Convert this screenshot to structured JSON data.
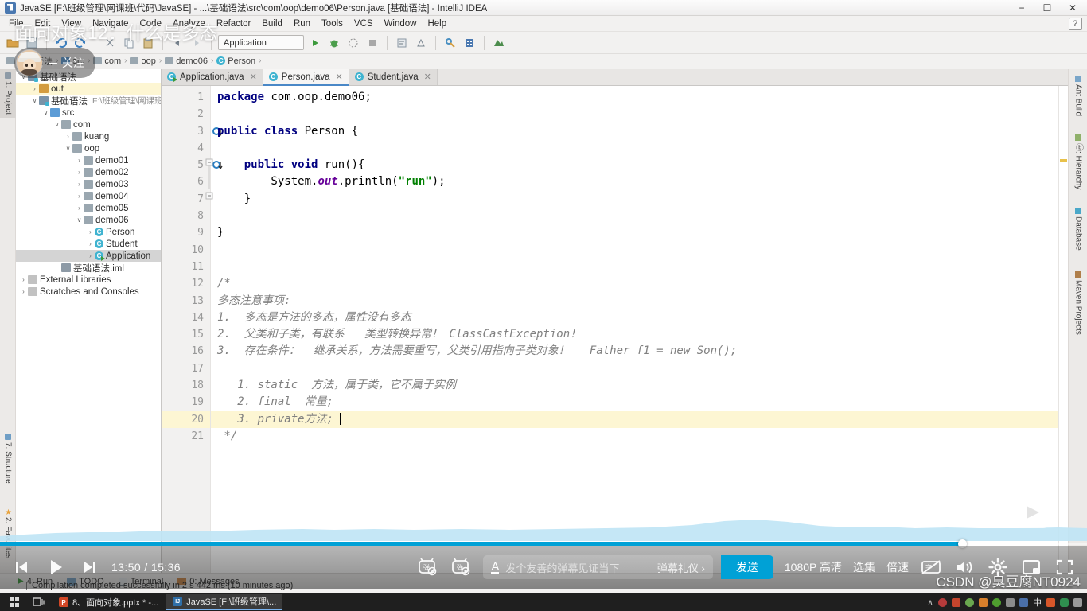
{
  "window": {
    "title": "JavaSE [F:\\班级管理\\网课班\\代码\\JavaSE] - ...\\基础语法\\src\\com\\oop\\demo06\\Person.java [基础语法] - IntelliJ IDEA",
    "minimize": "−",
    "maximize": "☐",
    "close": "✕",
    "help_badge": "?"
  },
  "menu": {
    "items": [
      "File",
      "Edit",
      "View",
      "Navigate",
      "Code",
      "Analyze",
      "Refactor",
      "Build",
      "Run",
      "Tools",
      "VCS",
      "Window",
      "Help"
    ]
  },
  "breadcrumb": {
    "items": [
      {
        "label": "基础语法",
        "icon": "module-icon"
      },
      {
        "label": "src",
        "icon": "source-folder-icon"
      },
      {
        "label": "com",
        "icon": "package-icon"
      },
      {
        "label": "oop",
        "icon": "package-icon"
      },
      {
        "label": "demo06",
        "icon": "package-icon"
      },
      {
        "label": "Person",
        "icon": "class-icon"
      }
    ],
    "separator": "›"
  },
  "toolbar": {
    "run_config": "Application"
  },
  "left_strip": {
    "tabs": [
      {
        "label": "1: Project",
        "selected": true
      },
      {
        "label": "7: Structure",
        "selected": false
      },
      {
        "label": "2: Favorites",
        "selected": false
      }
    ]
  },
  "right_strip": {
    "tabs": [
      {
        "label": "Ant Build"
      },
      {
        "label": "ⓑ: Hierarchy"
      },
      {
        "label": "Database"
      },
      {
        "label": "Maven Projects"
      }
    ]
  },
  "project_tree": {
    "rows": [
      {
        "label": "基础语法",
        "indent": 0,
        "arrow": "∨",
        "icon": "project-icon",
        "state": "normal",
        "path": ""
      },
      {
        "label": "out",
        "indent": 1,
        "arrow": "›",
        "icon": "folder-icon",
        "state": "highlight",
        "path": ""
      },
      {
        "label": "基础语法",
        "indent": 1,
        "arrow": "∨",
        "icon": "module-icon",
        "state": "normal",
        "path": "F:\\班级管理\\网课班\\代码\\Ja"
      },
      {
        "label": "src",
        "indent": 2,
        "arrow": "∨",
        "icon": "source-folder-icon",
        "state": "normal",
        "path": ""
      },
      {
        "label": "com",
        "indent": 3,
        "arrow": "∨",
        "icon": "package-icon",
        "state": "normal",
        "path": ""
      },
      {
        "label": "kuang",
        "indent": 4,
        "arrow": "›",
        "icon": "package-icon",
        "state": "normal",
        "path": ""
      },
      {
        "label": "oop",
        "indent": 4,
        "arrow": "∨",
        "icon": "package-icon",
        "state": "normal",
        "path": ""
      },
      {
        "label": "demo01",
        "indent": 5,
        "arrow": "›",
        "icon": "package-icon",
        "state": "normal",
        "path": ""
      },
      {
        "label": "demo02",
        "indent": 5,
        "arrow": "›",
        "icon": "package-icon",
        "state": "normal",
        "path": ""
      },
      {
        "label": "demo03",
        "indent": 5,
        "arrow": "›",
        "icon": "package-icon",
        "state": "normal",
        "path": ""
      },
      {
        "label": "demo04",
        "indent": 5,
        "arrow": "›",
        "icon": "package-icon",
        "state": "normal",
        "path": ""
      },
      {
        "label": "demo05",
        "indent": 5,
        "arrow": "›",
        "icon": "package-icon",
        "state": "normal",
        "path": ""
      },
      {
        "label": "demo06",
        "indent": 5,
        "arrow": "∨",
        "icon": "package-icon",
        "state": "normal",
        "path": ""
      },
      {
        "label": "Person",
        "indent": 6,
        "arrow": "›",
        "icon": "class-icon",
        "state": "normal",
        "path": ""
      },
      {
        "label": "Student",
        "indent": 6,
        "arrow": "›",
        "icon": "class-icon",
        "state": "normal",
        "path": ""
      },
      {
        "label": "Application",
        "indent": 6,
        "arrow": "›",
        "icon": "runnable-class-icon",
        "state": "selected",
        "path": ""
      },
      {
        "label": "基础语法.iml",
        "indent": 3,
        "arrow": "",
        "icon": "iml-icon",
        "state": "normal",
        "path": ""
      },
      {
        "label": "External Libraries",
        "indent": 0,
        "arrow": "›",
        "icon": "library-icon",
        "state": "normal",
        "path": ""
      },
      {
        "label": "Scratches and Consoles",
        "indent": 0,
        "arrow": "›",
        "icon": "scratch-icon",
        "state": "normal",
        "path": ""
      }
    ]
  },
  "editor_tabs": [
    {
      "label": "Application.java",
      "icon": "runnable-class-icon",
      "active": false,
      "close": "✕"
    },
    {
      "label": "Person.java",
      "icon": "class-icon",
      "active": true,
      "close": "✕"
    },
    {
      "label": "Student.java",
      "icon": "class-icon",
      "active": false,
      "close": "✕"
    }
  ],
  "code": {
    "lines": [
      {
        "n": 1,
        "html": "<span class=\"kw\">package</span> com.oop.demo06;",
        "gutter": "",
        "hl": false
      },
      {
        "n": 2,
        "html": "",
        "gutter": "",
        "hl": false
      },
      {
        "n": 3,
        "html": "<span class=\"kw\">public class</span> Person {",
        "gutter": "override-marker",
        "hl": false
      },
      {
        "n": 4,
        "html": "",
        "gutter": "",
        "hl": false
      },
      {
        "n": 5,
        "html": "    <span class=\"kw\">public void</span> run(){",
        "gutter": "override-marker",
        "hl": false
      },
      {
        "n": 6,
        "html": "        System.<span class=\"st\">out</span>.println(<span class=\"str\">\"run\"</span>);",
        "gutter": "",
        "hl": false
      },
      {
        "n": 7,
        "html": "    }",
        "gutter": "",
        "hl": false
      },
      {
        "n": 8,
        "html": "",
        "gutter": "",
        "hl": false
      },
      {
        "n": 9,
        "html": "}",
        "gutter": "",
        "hl": false
      },
      {
        "n": 10,
        "html": "",
        "gutter": "",
        "hl": false
      },
      {
        "n": 11,
        "html": "",
        "gutter": "",
        "hl": false
      },
      {
        "n": 12,
        "html": "<span class=\"cmt\">/*</span>",
        "gutter": "",
        "hl": false
      },
      {
        "n": 13,
        "html": "<span class=\"cmt\">多态注意事项:</span>",
        "gutter": "",
        "hl": false
      },
      {
        "n": 14,
        "html": "<span class=\"cmt\">1.  多态是方法的多态，属性没有多态</span>",
        "gutter": "",
        "hl": false
      },
      {
        "n": 15,
        "html": "<span class=\"cmt\">2.  父类和子类，有联系   类型转换异常！ ClassCastException！</span>",
        "gutter": "",
        "hl": false
      },
      {
        "n": 16,
        "html": "<span class=\"cmt\">3.  存在条件：  继承关系，方法需要重写，父类引用指向子类对象！   Father f1 = new Son();</span>",
        "gutter": "",
        "hl": false
      },
      {
        "n": 17,
        "html": "",
        "gutter": "",
        "hl": false
      },
      {
        "n": 18,
        "html": "<span class=\"cmt\">   1. static  方法，属于类，它不属于实例</span>",
        "gutter": "",
        "hl": false
      },
      {
        "n": 19,
        "html": "<span class=\"cmt\">   2. final  常量;</span>",
        "gutter": "",
        "hl": false
      },
      {
        "n": 20,
        "html": "<span class=\"cmt\">   3. private方法; </span><span class=\"caret\"></span>",
        "gutter": "intention-bulb",
        "hl": true
      },
      {
        "n": 21,
        "html": "<span class=\"cmt\"> */</span>",
        "gutter": "",
        "hl": false
      }
    ]
  },
  "bottom_tools": [
    {
      "label": "4: Run",
      "icon": "run-icon"
    },
    {
      "label": "TODO",
      "icon": "todo-icon"
    },
    {
      "label": "Terminal",
      "icon": "terminal-icon"
    },
    {
      "label": "0: Messages",
      "icon": "messages-icon"
    }
  ],
  "status": {
    "message": "Compilation completed successfully in 2 s 442 ms (10 minutes ago)",
    "icon": "event-log-icon"
  },
  "video": {
    "title": "面向对象12：什么是多态",
    "follow_label": "关注",
    "follow_plus": "＋",
    "time": "13:50 / 15:36",
    "progress_percent": 88.5,
    "danmaku_placeholder": "发个友善的弹幕见证当下",
    "danmaku_etiquette": "弹幕礼仪 ›",
    "send_label": "发送",
    "quality": "1080P 高清",
    "episodes": "选集",
    "speed": "倍速",
    "controls": [
      {
        "name": "previous-episode-button",
        "icon": "prev-icon"
      },
      {
        "name": "play-pause-button",
        "icon": "play-icon"
      },
      {
        "name": "next-episode-button",
        "icon": "next-icon"
      }
    ],
    "right_icons": [
      {
        "name": "subtitle-off-icon"
      },
      {
        "name": "volume-icon"
      },
      {
        "name": "settings-gear-icon"
      },
      {
        "name": "widescreen-icon"
      },
      {
        "name": "fullscreen-icon"
      }
    ],
    "danmaku_icons": [
      {
        "name": "danmaku-off-icon"
      },
      {
        "name": "danmaku-settings-icon"
      }
    ],
    "watermark": "CSDN @臭豆腐NT0924"
  },
  "taskbar": {
    "items": [
      {
        "label": "8、面向对象.pptx * -...",
        "icon": "powerpoint-icon",
        "color": "#d24726",
        "short": "P",
        "active": false
      },
      {
        "label": "JavaSE [F:\\班级管理\\...",
        "icon": "intellij-icon",
        "color": "#2f6fa8",
        "short": "IJ",
        "active": true
      }
    ],
    "start": "windows-logo-icon",
    "taskview": "task-view-icon",
    "tray_expand": "∧",
    "tray_lang": "中",
    "tray_time": ""
  }
}
